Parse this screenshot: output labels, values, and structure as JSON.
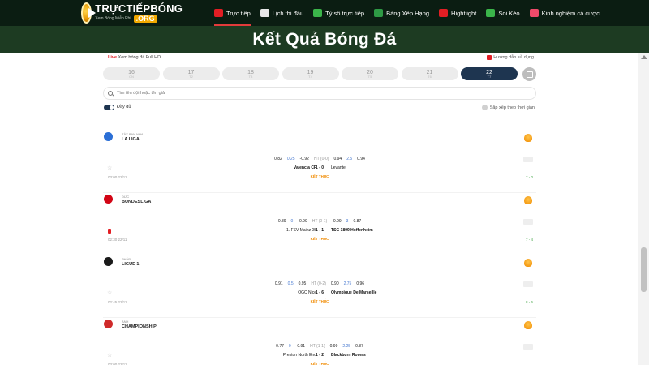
{
  "brand": {
    "name": "TRỰCTIẾPBÓNG",
    "slogan": "Xem Bóng Miễn Phí",
    "tld": ".ORG"
  },
  "nav": [
    {
      "label": "Trực tiếp",
      "icon": "live-icon",
      "color": "#e31e24",
      "active": true
    },
    {
      "label": "Lịch thi đấu",
      "icon": "calendar-icon",
      "color": "#e8e8e8"
    },
    {
      "label": "Tỷ số trực tiếp",
      "icon": "scoreboard-icon",
      "color": "#3bb54a"
    },
    {
      "label": "Bảng Xếp Hạng",
      "icon": "podium-icon",
      "color": "#2e9a45"
    },
    {
      "label": "Hightlight",
      "icon": "youtube-icon",
      "color": "#e31e24"
    },
    {
      "label": "Soi Kèo",
      "icon": "clipboard-icon",
      "color": "#3bb54a"
    },
    {
      "label": "Kinh nghiệm cá cược",
      "icon": "gift-icon",
      "color": "#f04a6a"
    }
  ],
  "page_title": "Kết Quả Bóng Đá",
  "live_badge": "Live",
  "live_text": "Xem bóng đá Full HD",
  "guide_text": "Hướng dẫn sử dụng",
  "dates": [
    {
      "day": "16",
      "weekday": "CN"
    },
    {
      "day": "17",
      "weekday": "T2"
    },
    {
      "day": "18",
      "weekday": "T3"
    },
    {
      "day": "19",
      "weekday": "T4"
    },
    {
      "day": "20",
      "weekday": "T5"
    },
    {
      "day": "21",
      "weekday": "T6"
    },
    {
      "day": "22",
      "weekday": "T7",
      "active": true
    }
  ],
  "search_placeholder": "Tìm tên đội hoặc tên giải",
  "toggle_label": "Đầy đủ",
  "sort_label": "Sắp xếp theo thời gian",
  "leagues": [
    {
      "country": "TÂY BAN NHA",
      "name": "LA LIGA",
      "flag_color": "#2b6fd6",
      "odds": {
        "a1": "0.82",
        "a2": "0.25",
        "a3": "-0.92",
        "ht": "HT (0-0)",
        "b1": "0.94",
        "b2": "2.5",
        "b3": "0.94"
      },
      "home": "Valencia CF",
      "score": "1 - 0",
      "away": "Levante",
      "home_bold": true,
      "status": "KẾT THÚC",
      "time": "03:00 22/11",
      "corner": "7 - 0",
      "red_card": false
    },
    {
      "country": "ĐỨC",
      "name": "BUNDESLIGA",
      "flag_color": "#d20515",
      "odds": {
        "a1": "0.89",
        "a2": "0",
        "a3": "-0.99",
        "ht": "HT (0-1)",
        "b1": "-0.99",
        "b2": "3",
        "b3": "0.87"
      },
      "home": "1. FSV Mainz 05",
      "score": "1 - 1",
      "away": "TSG 1899 Hoffenheim",
      "home_bold": false,
      "status": "KẾT THÚC",
      "time": "02:30 22/11",
      "corner": "7 - 4",
      "red_card": true
    },
    {
      "country": "PHÁP",
      "name": "LIGUE 1",
      "flag_color": "#1a1a1a",
      "odds": {
        "a1": "0.91",
        "a2": "0.5",
        "a3": "0.95",
        "ht": "HT (0-2)",
        "b1": "0.90",
        "b2": "2.75",
        "b3": "0.96"
      },
      "home": "OGC Nice",
      "score": "1 - 6",
      "away": "Olympique De Marseille",
      "home_bold": false,
      "status": "KẾT THÚC",
      "time": "02:45 22/11",
      "corner": "8 - 6",
      "red_card": false
    },
    {
      "country": "ANH",
      "name": "CHAMPIONSHIP",
      "flag_color": "#cf2a2a",
      "odds": {
        "a1": "0.77",
        "a2": "0",
        "a3": "-0.91",
        "ht": "HT (1-1)",
        "b1": "0.99",
        "b2": "2.25",
        "b3": "0.87"
      },
      "home": "Preston North End",
      "score": "1 - 2",
      "away": "Blackburn Rovers",
      "home_bold": false,
      "status": "KẾT THÚC",
      "time": "03:00 22/11",
      "corner": "",
      "red_card": false
    }
  ]
}
